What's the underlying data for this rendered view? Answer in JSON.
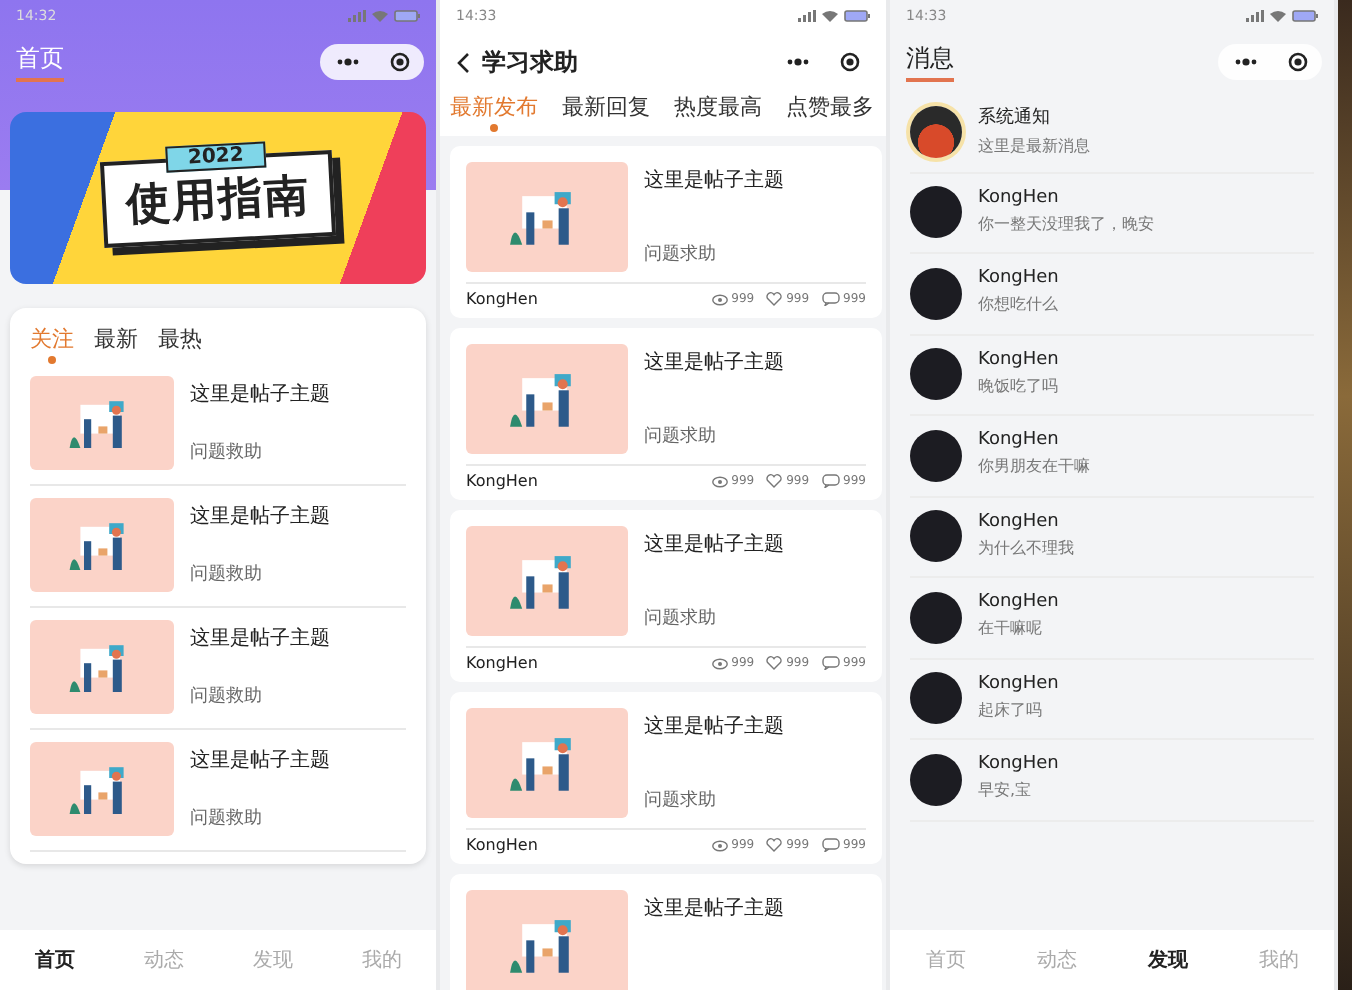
{
  "screens": [
    {
      "kind": "home",
      "status_bar": {
        "time": "14:32"
      },
      "header": {
        "title": "首页"
      },
      "banner": {
        "year": "2022",
        "title": "使用指南"
      },
      "tabs": [
        {
          "label": "关注",
          "selected": true
        },
        {
          "label": "最新",
          "selected": false
        },
        {
          "label": "最热",
          "selected": false
        }
      ],
      "posts": [
        {
          "title": "这里是帖子主题",
          "category": "问题救助"
        },
        {
          "title": "这里是帖子主题",
          "category": "问题救助"
        },
        {
          "title": "这里是帖子主题",
          "category": "问题救助"
        },
        {
          "title": "这里是帖子主题",
          "category": "问题救助"
        }
      ],
      "tab_bar": [
        {
          "label": "首页",
          "selected": true
        },
        {
          "label": "动态",
          "selected": false
        },
        {
          "label": "发现",
          "selected": false
        },
        {
          "label": "我的",
          "selected": false
        }
      ]
    },
    {
      "kind": "forum",
      "status_bar": {
        "time": "14:33"
      },
      "header": {
        "title": "学习求助"
      },
      "tabs": [
        {
          "label": "最新发布",
          "selected": true
        },
        {
          "label": "最新回复",
          "selected": false
        },
        {
          "label": "热度最高",
          "selected": false
        },
        {
          "label": "点赞最多",
          "selected": false
        }
      ],
      "posts": [
        {
          "title": "这里是帖子主题",
          "category": "问题求助",
          "author": "KongHen",
          "views": "999",
          "likes": "999",
          "comments": "999"
        },
        {
          "title": "这里是帖子主题",
          "category": "问题求助",
          "author": "KongHen",
          "views": "999",
          "likes": "999",
          "comments": "999"
        },
        {
          "title": "这里是帖子主题",
          "category": "问题求助",
          "author": "KongHen",
          "views": "999",
          "likes": "999",
          "comments": "999"
        },
        {
          "title": "这里是帖子主题",
          "category": "问题求助",
          "author": "KongHen",
          "views": "999",
          "likes": "999",
          "comments": "999"
        },
        {
          "title": "这里是帖子主题"
        }
      ]
    },
    {
      "kind": "messages",
      "status_bar": {
        "time": "14:33"
      },
      "header": {
        "title": "消息"
      },
      "messages": [
        {
          "kind": "system",
          "name": "系统通知",
          "preview": "这里是最新消息"
        },
        {
          "kind": "user",
          "name": "KongHen",
          "preview": "你一整天没理我了，晚安"
        },
        {
          "kind": "user",
          "name": "KongHen",
          "preview": "你想吃什么"
        },
        {
          "kind": "user",
          "name": "KongHen",
          "preview": "晚饭吃了吗"
        },
        {
          "kind": "user",
          "name": "KongHen",
          "preview": "你男朋友在干嘛"
        },
        {
          "kind": "user",
          "name": "KongHen",
          "preview": "为什么不理我"
        },
        {
          "kind": "user",
          "name": "KongHen",
          "preview": "在干嘛呢"
        },
        {
          "kind": "user",
          "name": "KongHen",
          "preview": "起床了吗"
        },
        {
          "kind": "user",
          "name": "KongHen",
          "preview": "早安,宝"
        }
      ],
      "tab_bar": [
        {
          "label": "首页",
          "selected": false
        },
        {
          "label": "动态",
          "selected": false
        },
        {
          "label": "发现",
          "selected": true
        },
        {
          "label": "我的",
          "selected": false
        }
      ]
    }
  ]
}
